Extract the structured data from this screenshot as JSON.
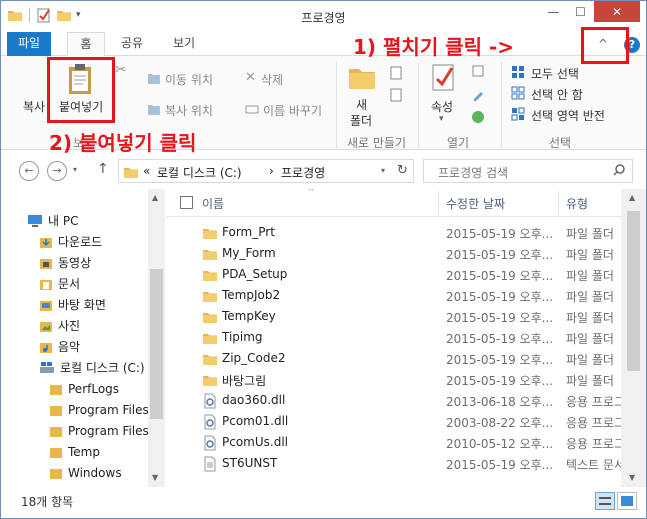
{
  "window": {
    "title": "프로경영",
    "close_label": "✕",
    "min_label": "—",
    "max_label": "☐"
  },
  "tabs": {
    "file": "파일",
    "home": "홈",
    "share": "공유",
    "view": "보기"
  },
  "ribbon": {
    "copy_partial": "복사",
    "paste": "붙여넣기",
    "clipboard_partial": "보",
    "move_to": "이동 위치",
    "copy_to": "복사 위치",
    "delete": "삭제",
    "rename": "이름 바꾸기",
    "new_folder_line1": "새",
    "new_folder_line2": "폴더",
    "properties": "속성",
    "select_all": "모두 선택",
    "select_none": "선택 안 함",
    "invert_selection": "선택 영역 반전",
    "group_organize_partial": "구성",
    "group_new": "새로 만들기",
    "group_open": "열기",
    "group_select": "선택"
  },
  "annotations": {
    "step1": "1) 펼치기 클릭 ->",
    "step2": "2) 붙여넣기 클릭"
  },
  "address": {
    "prefix": "«",
    "drive": "로컬 디스크 (C:)",
    "arrow": "›",
    "folder": "프로경영"
  },
  "search": {
    "placeholder": "프로경영 검색"
  },
  "nav": [
    {
      "label": "내 PC",
      "icon": "pc-icon"
    },
    {
      "label": "다운로드",
      "icon": "download-folder-icon"
    },
    {
      "label": "동영상",
      "icon": "video-folder-icon"
    },
    {
      "label": "문서",
      "icon": "documents-folder-icon"
    },
    {
      "label": "바탕 화면",
      "icon": "desktop-folder-icon"
    },
    {
      "label": "사진",
      "icon": "pictures-folder-icon"
    },
    {
      "label": "음악",
      "icon": "music-folder-icon"
    },
    {
      "label": "로컬 디스크 (C:)",
      "icon": "drive-icon"
    },
    {
      "label": "PerfLogs",
      "icon": "folder-icon"
    },
    {
      "label": "Program Files",
      "icon": "folder-icon"
    },
    {
      "label": "Program Files (",
      "icon": "folder-icon"
    },
    {
      "label": "Temp",
      "icon": "folder-icon"
    },
    {
      "label": "Windows",
      "icon": "folder-icon"
    }
  ],
  "columns": {
    "name": "이름",
    "date": "수정한 날짜",
    "type": "유형"
  },
  "files": [
    {
      "name": "Form_Prt",
      "date": "2015-05-19 오후...",
      "type": "파일 폴더",
      "kind": "folder"
    },
    {
      "name": "My_Form",
      "date": "2015-05-19 오후...",
      "type": "파일 폴더",
      "kind": "folder"
    },
    {
      "name": "PDA_Setup",
      "date": "2015-05-19 오후...",
      "type": "파일 폴더",
      "kind": "folder"
    },
    {
      "name": "TempJob2",
      "date": "2015-05-19 오후...",
      "type": "파일 폴더",
      "kind": "folder"
    },
    {
      "name": "TempKey",
      "date": "2015-05-19 오후...",
      "type": "파일 폴더",
      "kind": "folder"
    },
    {
      "name": "Tipimg",
      "date": "2015-05-19 오후...",
      "type": "파일 폴더",
      "kind": "folder"
    },
    {
      "name": "Zip_Code2",
      "date": "2015-05-19 오후...",
      "type": "파일 폴더",
      "kind": "folder"
    },
    {
      "name": "바탕그림",
      "date": "2015-05-19 오후...",
      "type": "파일 폴더",
      "kind": "folder"
    },
    {
      "name": "dao360.dll",
      "date": "2013-06-18 오후...",
      "type": "응용 프로그",
      "kind": "dll"
    },
    {
      "name": "Pcom01.dll",
      "date": "2003-08-22 오후...",
      "type": "응용 프로그",
      "kind": "dll"
    },
    {
      "name": "PcomUs.dll",
      "date": "2010-05-12 오후...",
      "type": "응용 프로그",
      "kind": "dll"
    },
    {
      "name": "ST6UNST",
      "date": "2015-05-19 오후...",
      "type": "텍스트 문서",
      "kind": "text"
    }
  ],
  "status": {
    "count": "18개 항목"
  },
  "colors": {
    "accent": "#1979ca",
    "annotation": "#e8141b",
    "folder": "#e8b64a"
  }
}
